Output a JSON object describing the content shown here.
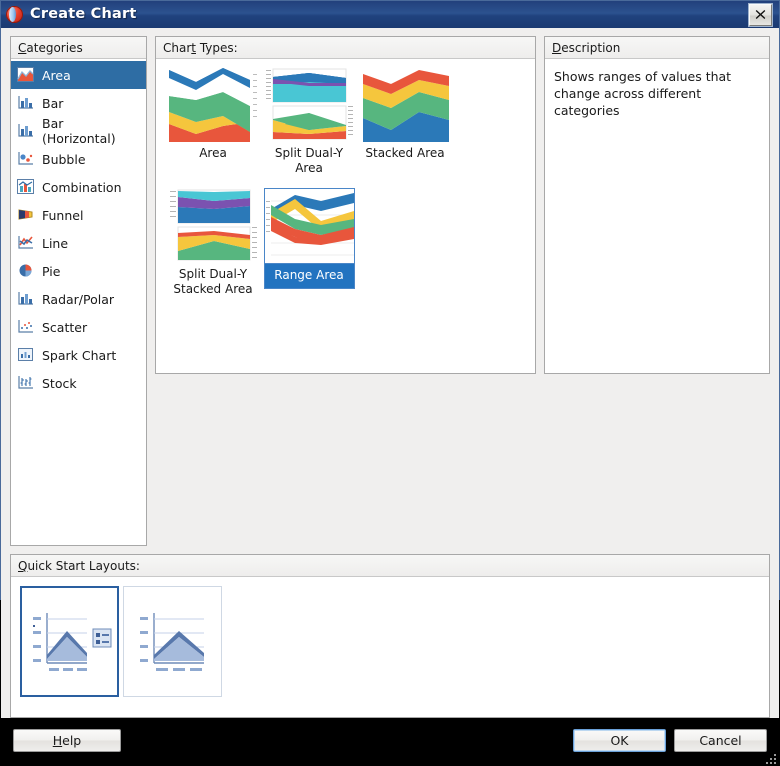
{
  "window": {
    "title": "Create Chart",
    "icon": "oracle-sphere-icon",
    "close_label": "×"
  },
  "categories": {
    "header": "Categories",
    "header_accel": "C",
    "selected": "Area",
    "items": [
      {
        "label": "Area",
        "icon": "area-chart-icon"
      },
      {
        "label": "Bar",
        "icon": "bar-chart-icon"
      },
      {
        "label": "Bar (Horizontal)",
        "icon": "bar-horizontal-chart-icon"
      },
      {
        "label": "Bubble",
        "icon": "bubble-chart-icon"
      },
      {
        "label": "Combination",
        "icon": "combination-chart-icon"
      },
      {
        "label": "Funnel",
        "icon": "funnel-chart-icon"
      },
      {
        "label": "Line",
        "icon": "line-chart-icon"
      },
      {
        "label": "Pie",
        "icon": "pie-chart-icon"
      },
      {
        "label": "Radar/Polar",
        "icon": "radar-polar-chart-icon"
      },
      {
        "label": "Scatter",
        "icon": "scatter-chart-icon"
      },
      {
        "label": "Spark Chart",
        "icon": "spark-chart-icon"
      },
      {
        "label": "Stock",
        "icon": "stock-chart-icon"
      }
    ]
  },
  "chart_types": {
    "header": "Chart Types:",
    "header_accel": "t",
    "selected": "Range Area",
    "items": [
      {
        "label": "Area",
        "thumb": "area-thumb",
        "selected": false
      },
      {
        "label": "Split Dual-Y Area",
        "thumb": "split-dual-y-area-thumb",
        "selected": false
      },
      {
        "label": "Stacked Area",
        "thumb": "stacked-area-thumb",
        "selected": false
      },
      {
        "label": "Split Dual-Y Stacked Area",
        "thumb": "split-dual-y-stacked-area-thumb",
        "selected": false
      },
      {
        "label": "Range Area",
        "thumb": "range-area-thumb",
        "selected": true
      }
    ]
  },
  "description": {
    "header": "Description",
    "header_accel": "D",
    "text": "Shows ranges of values that change across different categories"
  },
  "quick_start": {
    "header": "Quick Start Layouts:",
    "header_accel": "Q",
    "items": [
      {
        "name": "area-with-legend-layout",
        "selected": true
      },
      {
        "name": "area-plain-layout",
        "selected": false
      }
    ]
  },
  "footer": {
    "help": "Help",
    "help_accel": "H",
    "ok": "OK",
    "cancel": "Cancel"
  },
  "palette": {
    "blue": "#2b79b8",
    "green": "#57b67f",
    "yellow": "#f5c63d",
    "orange": "#e8563c",
    "purple": "#7b52b0",
    "cyan": "#49c6d4",
    "selection_blue": "#2e6da4",
    "title_blue": "#22407c",
    "thumb_sel_blue": "#2273c0"
  }
}
